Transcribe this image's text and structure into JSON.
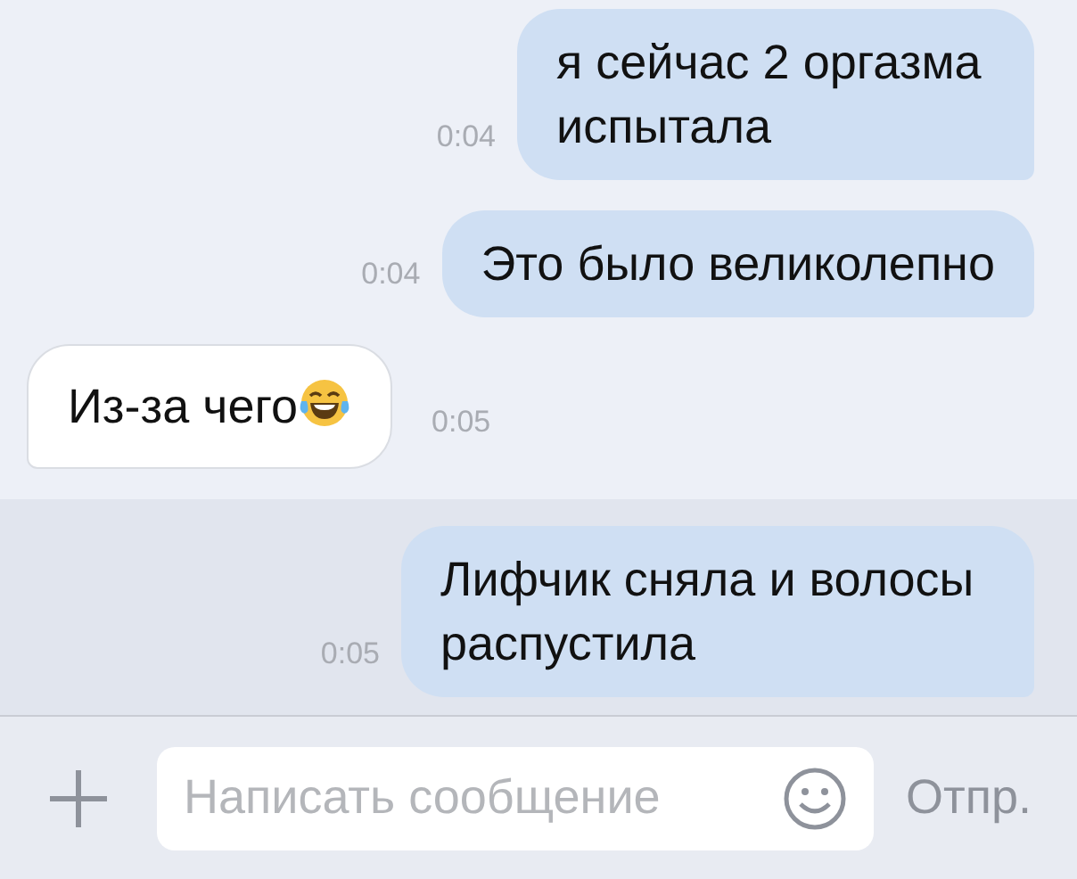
{
  "messages": [
    {
      "kind": "outgoing",
      "text": "я сейчас 2 оргазма испытала",
      "time": "0:04",
      "selected": false
    },
    {
      "kind": "outgoing",
      "text": "Это было великолепно",
      "time": "0:04",
      "selected": false
    },
    {
      "kind": "incoming",
      "text": "Из-за чего",
      "emoji": true,
      "time": "0:05",
      "selected": false
    },
    {
      "kind": "outgoing",
      "text": "Лифчик сняла и волосы распустила",
      "time": "0:05",
      "selected": true
    }
  ],
  "composer": {
    "placeholder": "Написать сообщение",
    "send": "Отпр."
  }
}
